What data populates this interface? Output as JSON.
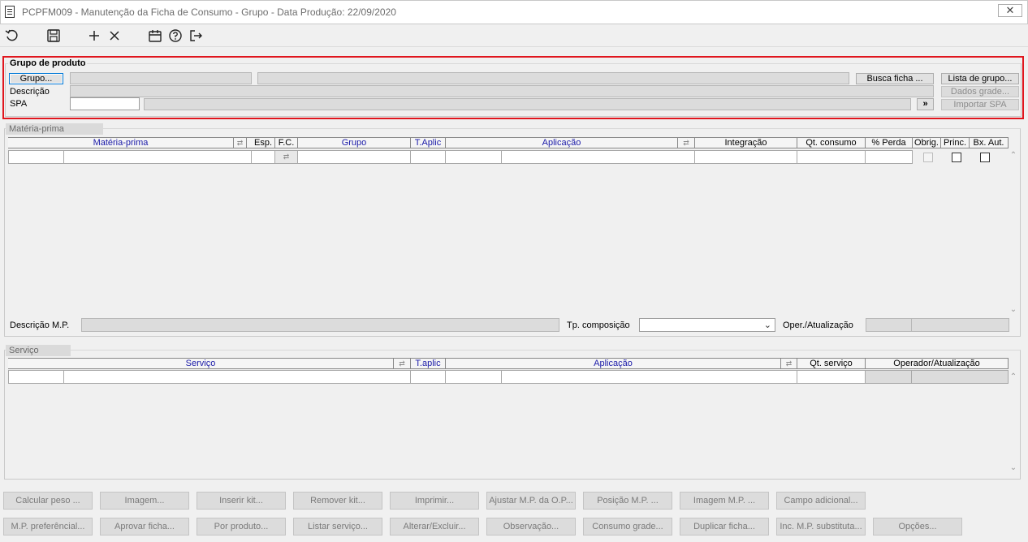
{
  "window": {
    "title": "PCPFM009 - Manutenção da Ficha de Consumo - Grupo - Data Produção: 22/09/2020",
    "close_label": "✕"
  },
  "toolbar": {
    "icons": [
      "refresh-icon",
      "save-icon",
      "add-icon",
      "delete-icon",
      "calendar-icon",
      "help-icon",
      "exit-icon"
    ]
  },
  "grupo_produto": {
    "legend": "Grupo de produto",
    "grupo_button": "Grupo...",
    "descricao_label": "Descrição",
    "spa_label": "SPA",
    "spa_value": "",
    "busca_ficha_button": "Busca ficha ...",
    "lista_grupo_button": "Lista de grupo...",
    "dados_grade_button": "Dados grade...",
    "importar_spa_button": "Importar SPA",
    "nav_button": "»"
  },
  "materia_prima": {
    "legend": "Matéria-prima",
    "columns": [
      "Matéria-prima",
      "Esp.",
      "F.C.",
      "Grupo",
      "T.Aplic",
      "Aplicação",
      "Integração",
      "Qt. consumo",
      "% Perda",
      "Obrig.",
      "Princ.",
      "Bx. Aut."
    ],
    "descricao_label": "Descrição M.P.",
    "tp_composicao_label": "Tp. composição",
    "oper_label": "Oper./Atualização"
  },
  "servico": {
    "legend": "Serviço",
    "columns": [
      "Serviço",
      "T.aplic",
      "Aplicação",
      "Qt. serviço",
      "Operador/Atualização"
    ]
  },
  "bottom_buttons_row1": [
    "Calcular peso ...",
    "Imagem...",
    "Inserir kit...",
    "Remover kit...",
    "Imprimir...",
    "Ajustar M.P. da O.P...",
    "Posição M.P. ...",
    "Imagem M.P. ...",
    "Campo adicional..."
  ],
  "bottom_buttons_row2": [
    "M.P. preferêncial...",
    "Aprovar ficha...",
    "Por produto...",
    "Listar serviço...",
    "Alterar/Excluir...",
    "Observação...",
    "Consumo grade...",
    "Duplicar ficha...",
    "Inc. M.P. substituta...",
    "Opções..."
  ],
  "colors": {
    "highlight": "#e0161e",
    "header_blue": "#1a1aa8",
    "focus": "#0078d7"
  }
}
